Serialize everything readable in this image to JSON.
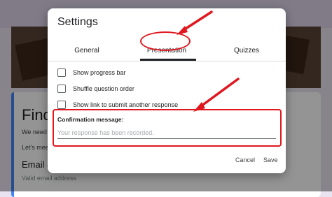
{
  "background": {
    "form_title": "Find",
    "description_line_1": "We need t",
    "description_line_2": "Let's meet",
    "field_label": "Email ad",
    "field_hint": "Valid email address"
  },
  "dialog": {
    "title": "Settings",
    "tabs": [
      {
        "label": "General"
      },
      {
        "label": "Presentation",
        "selected": true
      },
      {
        "label": "Quizzes"
      }
    ],
    "options": [
      {
        "label": "Show progress bar",
        "checked": false
      },
      {
        "label": "Shuffle question order",
        "checked": false
      },
      {
        "label": "Show link to submit another response",
        "checked": false
      }
    ],
    "confirmation": {
      "label": "Confirmation message:",
      "placeholder": "Your response has been recorded.",
      "value": ""
    },
    "buttons": {
      "cancel": "Cancel",
      "save": "Save"
    }
  },
  "annotations": {
    "highlight_color": "#e0171e",
    "targets": [
      "Presentation tab",
      "Confirmation message field"
    ]
  }
}
